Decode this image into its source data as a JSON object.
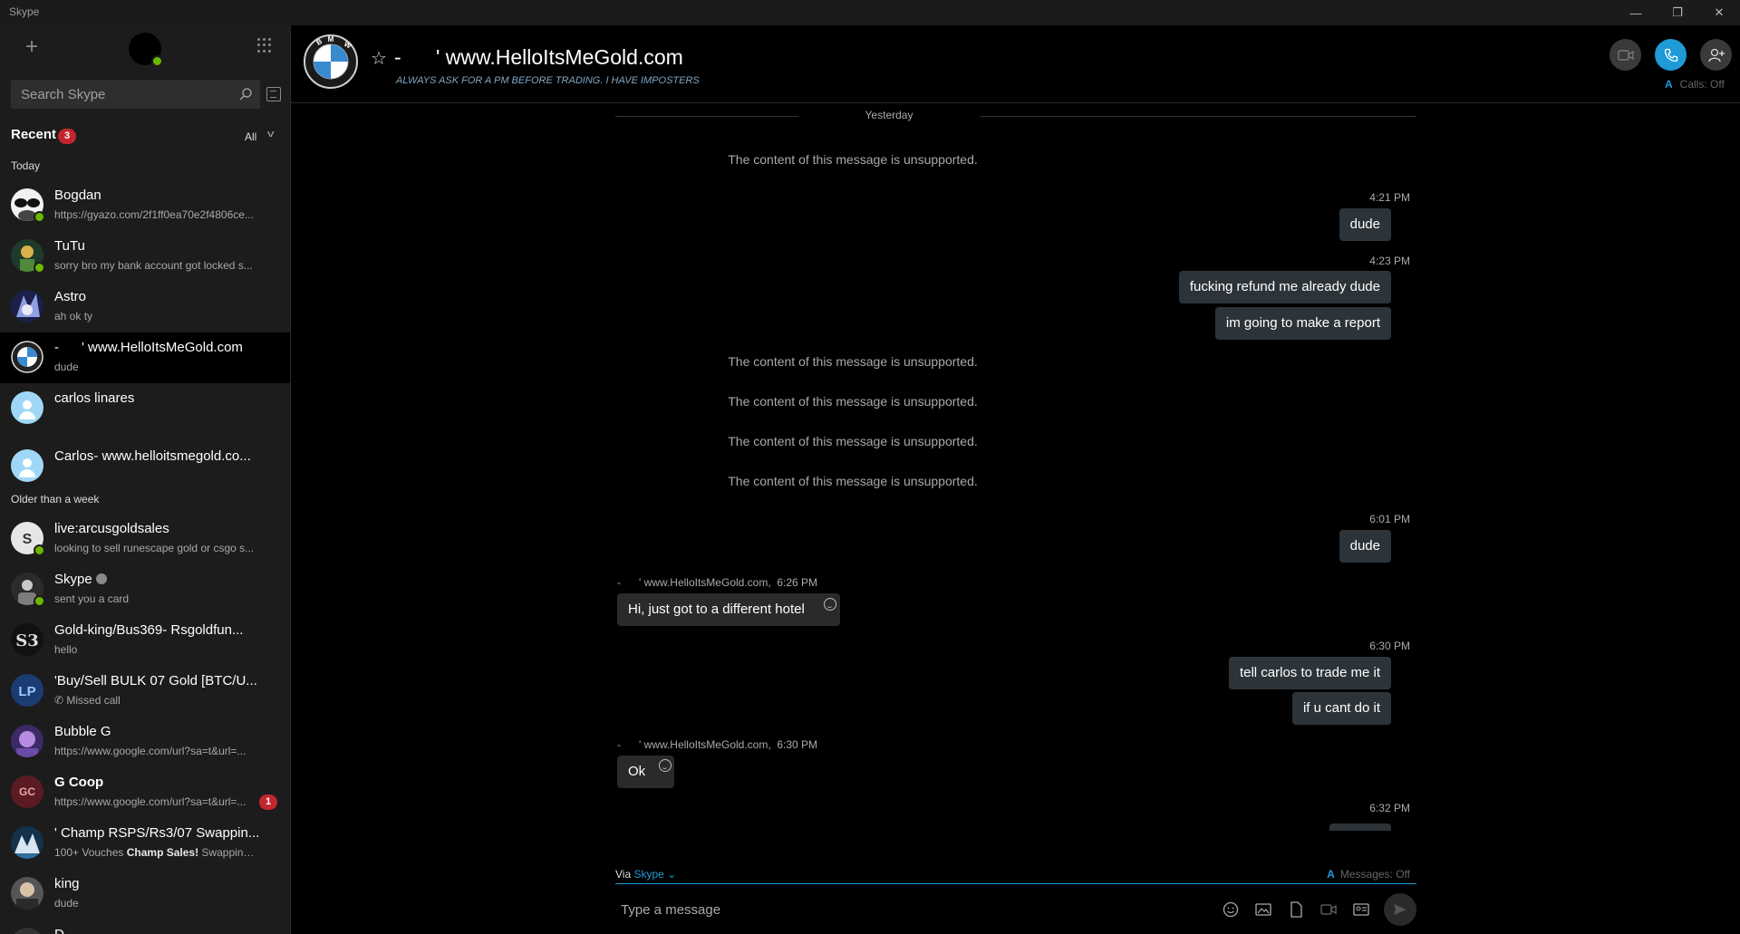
{
  "window": {
    "title": "Skype",
    "controls": {
      "minimize": "—",
      "restore": "❐",
      "close": "✕"
    }
  },
  "sidebar": {
    "search_placeholder": "Search Skype",
    "recent_label": "Recent",
    "recent_badge": "3",
    "filter_label": "All",
    "sections": {
      "today": "Today",
      "older": "Older than a week"
    },
    "conversations": [
      {
        "name": "Bogdan",
        "preview": "https://gyazo.com/2f1ff0ea70e2f4806ce...",
        "online": true
      },
      {
        "name": "TuTu",
        "preview": "sorry bro my bank account got locked s...",
        "online": true
      },
      {
        "name": "Astro",
        "preview": "ah ok ty",
        "online": false
      },
      {
        "name": "-      ' www.HelloItsMeGold.com",
        "preview": "dude",
        "online": false,
        "active": true
      },
      {
        "name": "carlos linares",
        "preview": "",
        "online": false
      },
      {
        "name": "Carlos- www.helloitsmegold.co...",
        "preview": "",
        "online": false
      },
      {
        "name": "live:arcusgoldsales",
        "preview": "looking to sell runescape gold or csgo s...",
        "online": true
      },
      {
        "name": "Skype",
        "preview": "sent you a card",
        "online": true,
        "verified": true
      },
      {
        "name": "Gold-king/Bus369- Rsgoldfun...",
        "preview": "hello",
        "online": false
      },
      {
        "name": "'Buy/Sell BULK 07 Gold [BTC/U...",
        "preview": "Missed call",
        "online": false,
        "missed_call": true
      },
      {
        "name": "Bubble G",
        "preview": "https://www.google.com/url?sa=t&url=...",
        "online": false
      },
      {
        "name": "G Coop",
        "preview": "https://www.google.com/url?sa=t&url=...",
        "online": false,
        "initials": "GC",
        "unread": "1",
        "bold": true
      },
      {
        "name": "' Champ RSPS/Rs3/07 Swappin...",
        "preview_pre": "100+ Vouches ",
        "preview_bold": "Champ Sales!",
        "preview_post": " Swapping...",
        "online": false
      },
      {
        "name": "king",
        "preview": "dude",
        "online": false
      },
      {
        "name": "D...",
        "preview": "",
        "online": false
      }
    ]
  },
  "header": {
    "title": "-      ' www.HelloItsMeGold.com",
    "mood": "ALWAYS ASK FOR A PM BEFORE TRADING. I HAVE IMPOSTERS",
    "calls_translate": "Calls: Off"
  },
  "chat": {
    "date_separator": "Yesterday",
    "unsupported_text": "The content of this message is unsupported.",
    "messages": [
      {
        "time": "4:21 PM",
        "text": "dude"
      },
      {
        "time": "4:23 PM",
        "text": "fucking refund me already dude"
      },
      {
        "text": "im going to make a report"
      },
      {
        "time": "6:01 PM",
        "text": "dude"
      },
      {
        "sender": "-      ' www.HelloItsMeGold.com,  6:26 PM",
        "text": "Hi, just got to a different hotel"
      },
      {
        "time": "6:30 PM",
        "text": "tell carlos to trade me it"
      },
      {
        "text": "if u cant do it"
      },
      {
        "sender": "-      ' www.HelloItsMeGold.com,  6:30 PM",
        "text": "Ok"
      },
      {
        "time": "6:32 PM",
        "text": ""
      }
    ]
  },
  "composer": {
    "via_label": "Via",
    "via_service": "Skype",
    "messages_translate": "Messages: Off",
    "placeholder": "Type a message"
  },
  "colors": {
    "accent": "#1e9ad6",
    "online": "#6bb700",
    "badge": "#c4262e",
    "outgoing_bubble": "#2d3439"
  }
}
